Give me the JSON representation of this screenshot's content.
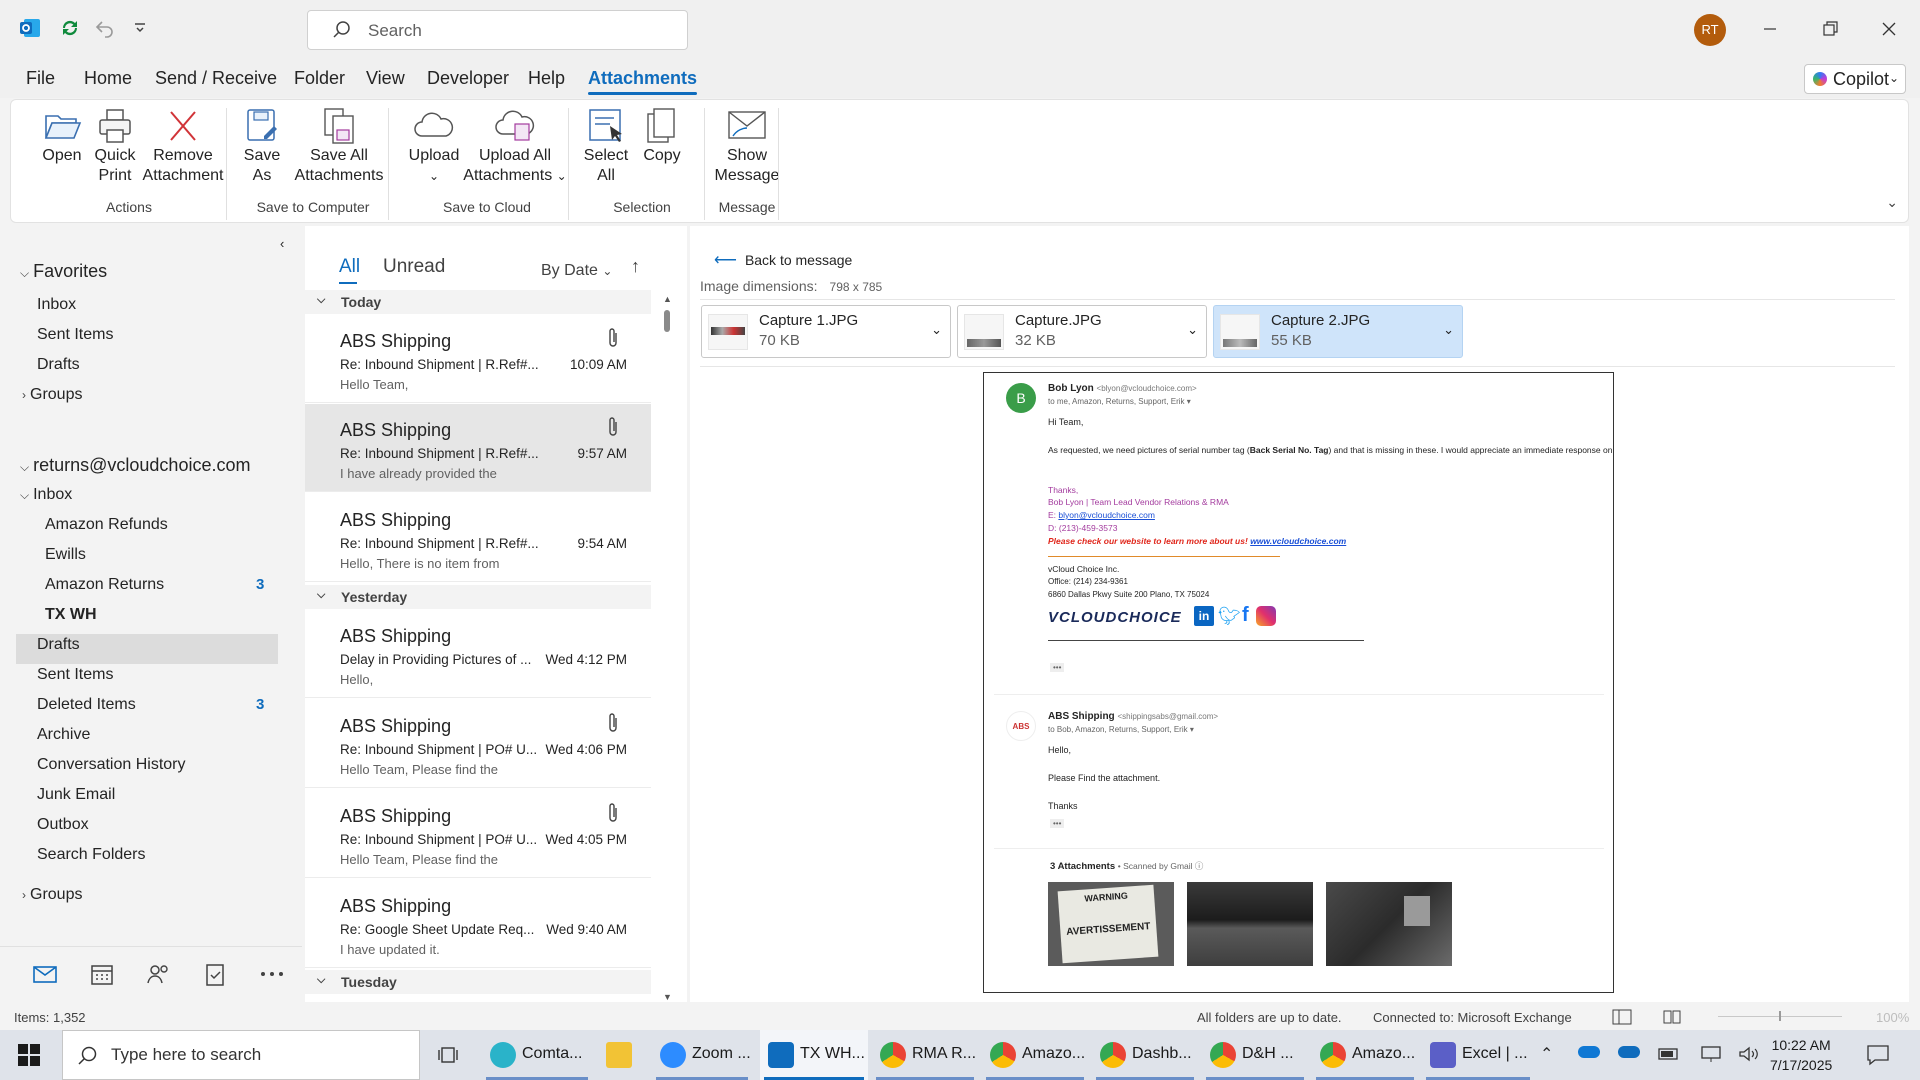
{
  "titlebar": {
    "search_placeholder": "Search",
    "avatar_initials": "RT"
  },
  "menu": {
    "tabs": [
      "File",
      "Home",
      "Send / Receive",
      "Folder",
      "View",
      "Developer",
      "Help",
      "Attachments"
    ],
    "active": "Attachments",
    "copilot": "Copilot"
  },
  "ribbon": {
    "buttons": {
      "open": "Open",
      "quick_print_1": "Quick",
      "quick_print_2": "Print",
      "remove_1": "Remove",
      "remove_2": "Attachment",
      "save_as_1": "Save",
      "save_as_2": "As",
      "save_all_1": "Save All",
      "save_all_2": "Attachments",
      "upload_1": "Upload",
      "upload_all_1": "Upload All",
      "upload_all_2": "Attachments",
      "select_all_1": "Select",
      "select_all_2": "All",
      "copy": "Copy",
      "show_msg_1": "Show",
      "show_msg_2": "Message"
    },
    "groups": {
      "actions": "Actions",
      "save_to_computer": "Save to Computer",
      "save_to_cloud": "Save to Cloud",
      "selection": "Selection",
      "message": "Message"
    }
  },
  "folders": {
    "favorites": "Favorites",
    "fav_items": [
      "Inbox",
      "Sent Items",
      "Drafts"
    ],
    "groups1": "Groups",
    "account": "returns@vcloudchoice.com",
    "inbox": "Inbox",
    "inbox_children": [
      "Amazon Refunds",
      "Ewills",
      "Amazon Returns",
      "TX WH"
    ],
    "amazon_returns_count": "3",
    "others": [
      "Drafts",
      "Sent Items",
      "Deleted Items",
      "Archive",
      "Conversation History",
      "Junk Email",
      "Outbox",
      "Search Folders"
    ],
    "deleted_count": "3",
    "groups2": "Groups"
  },
  "messages": {
    "tab_all": "All",
    "tab_unread": "Unread",
    "sort": "By Date",
    "group_today": "Today",
    "group_yesterday": "Yesterday",
    "group_tuesday": "Tuesday",
    "items": [
      {
        "from": "ABS Shipping",
        "subject": "Re: Inbound Shipment | R.Ref#...",
        "preview": "Hello Team,",
        "time": "10:09 AM"
      },
      {
        "from": "ABS Shipping",
        "subject": "Re: Inbound Shipment | R.Ref#...",
        "preview": "I have already provided the",
        "time": "9:57 AM"
      },
      {
        "from": "ABS Shipping",
        "subject": "Re: Inbound Shipment | R.Ref#...",
        "preview": "Hello,  There is no item from",
        "time": "9:54 AM"
      },
      {
        "from": "ABS Shipping",
        "subject": "Delay in Providing Pictures of ...",
        "preview": "Hello,",
        "time": "Wed 4:12 PM"
      },
      {
        "from": "ABS Shipping",
        "subject": "Re: Inbound Shipment | PO# U...",
        "preview": "Hello Team,  Please find the",
        "time": "Wed 4:06 PM"
      },
      {
        "from": "ABS Shipping",
        "subject": "Re: Inbound Shipment | PO# U...",
        "preview": "Hello Team,  Please find the",
        "time": "Wed 4:05 PM"
      },
      {
        "from": "ABS Shipping",
        "subject": "Re: Google Sheet Update Req...",
        "preview": "I have updated it.",
        "time": "Wed 9:40 AM"
      }
    ]
  },
  "reading": {
    "back": "Back to message",
    "dims_label": "Image dimensions:",
    "dims_value": "798 x 785",
    "attachments": [
      {
        "name": "Capture 1.JPG",
        "size": "70 KB"
      },
      {
        "name": "Capture.JPG",
        "size": "32 KB"
      },
      {
        "name": "Capture 2.JPG",
        "size": "55 KB"
      }
    ],
    "preview": {
      "avatar": "B",
      "sender1": "Bob Lyon",
      "sender1_email": "<blyon@vcloudchoice.com>",
      "to1": "to me, Amazon, Returns, Support, Erik ▾",
      "hi": "Hi Team,",
      "body_a": "As requested, we need pictures of serial number tag (",
      "body_b": "Back Serial No. Tag",
      "body_c": ") and that is missing in these. I would appreciate an immediate response on",
      "thanks": "Thanks,",
      "sig_name": "Bob Lyon | Team Lead Vendor Relations & RMA",
      "sig_e": "E: ",
      "sig_email": "blyon@vcloudchoice.com",
      "sig_phone": "D: (213)-459-3573",
      "sig_promo": "Please check our website to learn more about us! ",
      "sig_web": "www.vcloudchoice.com",
      "co_name": "vCloud Choice Inc.",
      "co_office": "Office: (214) 234-9361",
      "co_addr": "6860 Dallas Pkwy Suite 200 Plano, TX 75024",
      "logo": "VCLOUDCHOICE",
      "dots": "•••",
      "sender2": "ABS Shipping",
      "sender2_email": "<shippingsabs@gmail.com>",
      "to2": "to Bob, Amazon, Returns, Support, Erik ▾",
      "hello": "Hello,",
      "please": "Please Find the attachment.",
      "thanks2": "Thanks",
      "att_hdr": "3 Attachments",
      "scanned": "• Scanned by Gmail ⓘ",
      "warn1": "WARNING",
      "warn2": "AVERTISSEMENT"
    }
  },
  "status": {
    "items": "Items: 1,352",
    "sync": "All folders are up to date.",
    "conn": "Connected to: Microsoft Exchange",
    "zoom": "100%"
  },
  "taskbar": {
    "search": "Type here to search",
    "apps": [
      "Comta...",
      "Zoom ...",
      "TX WH...",
      "RMA R...",
      "Amazo...",
      "Dashb...",
      "D&H ...",
      "Amazo...",
      "Excel | ..."
    ],
    "time": "10:22 AM",
    "date": "7/17/2025"
  },
  "colors": {
    "accent": "#0f6cbd",
    "avatar": "#b35c0c",
    "selected_attachment": "#cfe4fa"
  }
}
